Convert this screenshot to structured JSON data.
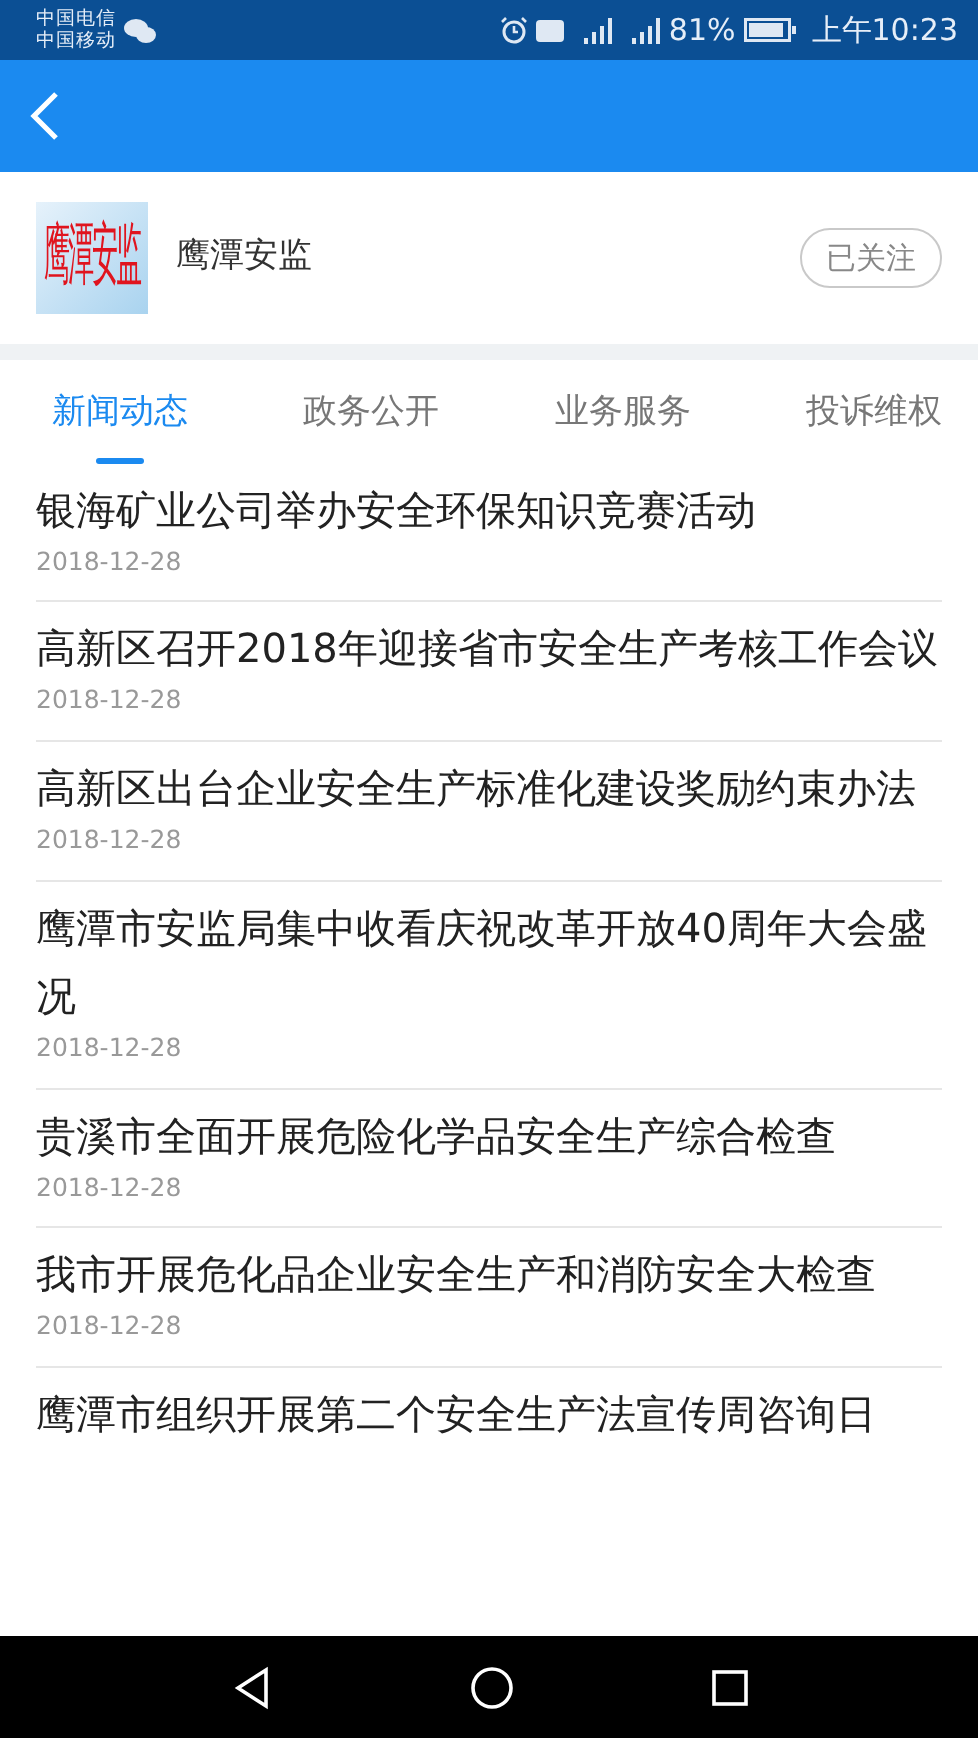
{
  "status_bar": {
    "carriers": [
      "中国电信",
      "中国移动"
    ],
    "battery": "81%",
    "time": "上午10:23"
  },
  "account": {
    "logo_text": "鹰潭安监",
    "name": "鹰潭安监",
    "follow_button": "已关注"
  },
  "tabs": [
    {
      "label": "新闻动态",
      "selected": true
    },
    {
      "label": "政务公开",
      "selected": false
    },
    {
      "label": "业务服务",
      "selected": false
    },
    {
      "label": "投诉维权",
      "selected": false
    }
  ],
  "news": [
    {
      "title": "银海矿业公司举办安全环保知识竞赛活动",
      "date": "2018-12-28"
    },
    {
      "title": "高新区召开2018年迎接省市安全生产考核工作会议",
      "date": "2018-12-28"
    },
    {
      "title": "高新区出台企业安全生产标准化建设奖励约束办法",
      "date": "2018-12-28"
    },
    {
      "title": "鹰潭市安监局集中收看庆祝改革开放40周年大会盛况",
      "date": "2018-12-28"
    },
    {
      "title": "贵溪市全面开展危险化学品安全生产综合检查",
      "date": "2018-12-28"
    },
    {
      "title": "我市开展危化品企业安全生产和消防安全大检查",
      "date": "2018-12-28"
    },
    {
      "title": "鹰潭市组织开展第二个安全生产法宣传周咨询日"
    }
  ]
}
